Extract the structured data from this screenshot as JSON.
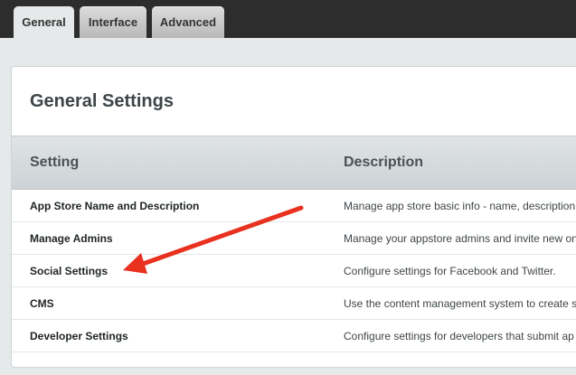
{
  "tabs": [
    {
      "label": "General",
      "active": true
    },
    {
      "label": "Interface",
      "active": false
    },
    {
      "label": "Advanced",
      "active": false
    }
  ],
  "panel": {
    "title": "General Settings",
    "columns": {
      "setting": "Setting",
      "description": "Description"
    },
    "rows": [
      {
        "setting": "App Store Name and Description",
        "description": "Manage app store basic info - name, description"
      },
      {
        "setting": "Manage Admins",
        "description": "Manage your appstore admins and invite new on"
      },
      {
        "setting": "Social Settings",
        "description": "Configure settings for Facebook and Twitter."
      },
      {
        "setting": "CMS",
        "description": "Use the content management system to create s"
      },
      {
        "setting": "Developer Settings",
        "description": "Configure settings for developers that submit ap"
      }
    ]
  },
  "annotation": {
    "icon": "red-arrow-icon",
    "color": "#e8311f"
  }
}
